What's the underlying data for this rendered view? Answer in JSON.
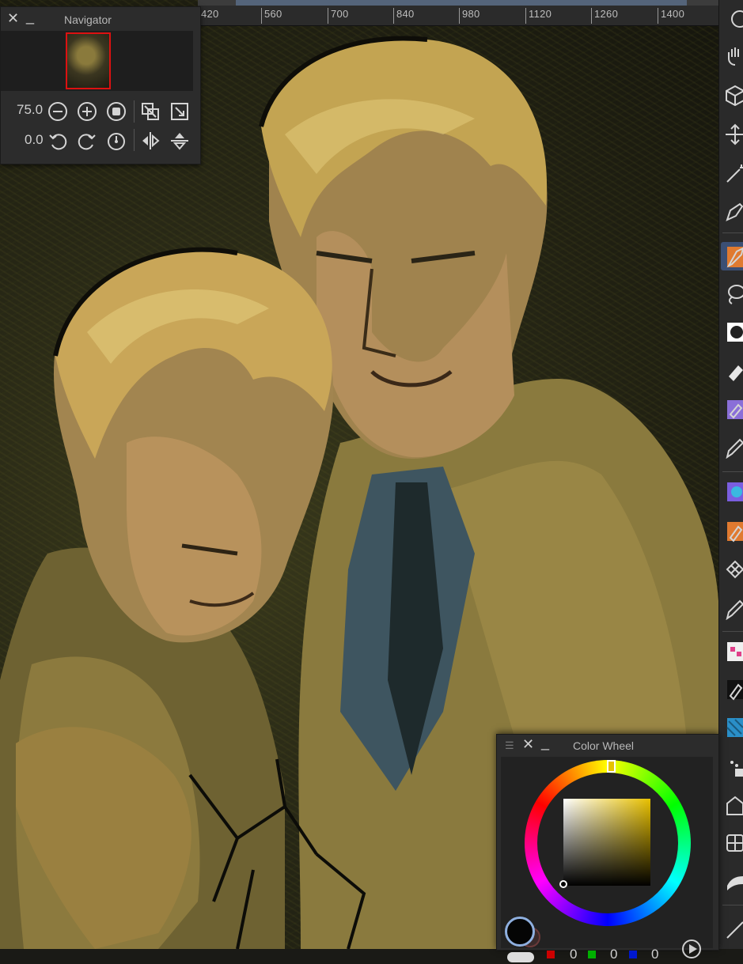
{
  "app": {
    "panels": {
      "navigator": {
        "title": "Navigator",
        "close_glyph": "✕",
        "minimize_glyph": "_",
        "zoom_value": "75.0",
        "rotation_value": "0.0",
        "icons": [
          "zoom-out-icon",
          "zoom-in-icon",
          "zoom-reset-icon",
          "fit-canvas-icon",
          "actual-size-icon",
          "rotate-ccw-icon",
          "rotate-cw-icon",
          "rotation-reset-icon",
          "flip-horizontal-icon",
          "flip-vertical-icon"
        ]
      },
      "color_wheel": {
        "title": "Color Wheel",
        "close_glyph": "✕",
        "minimize_glyph": "_",
        "grip_glyph": "☰",
        "selected_hue": "#e6c200",
        "foreground_color": "#050505",
        "r_value": "0",
        "g_value": "0",
        "b_value": "0",
        "channel_colors": {
          "r": "#cc0000",
          "g": "#00b000",
          "b": "#0018d0"
        }
      }
    },
    "ruler": {
      "labels": [
        "420",
        "560",
        "700",
        "840",
        "980",
        "1120",
        "1260",
        "1400"
      ]
    },
    "toolbar": {
      "tools": [
        "ellipse-select-icon",
        "hand-icon",
        "3d-cube-icon",
        "move-icon",
        "magic-wand-icon",
        "pen-icon",
        "brush-icon",
        "lasso-icon",
        "fill-color-icon",
        "eraser-icon",
        "gradient-icon",
        "pencil-icon",
        "watercolor-icon",
        "marker-icon",
        "pattern-icon",
        "ink-icon",
        "decoration-icon",
        "dark-brush-icon",
        "texture-icon",
        "spray-icon",
        "shape-icon",
        "grid-icon",
        "smudge-icon",
        "line-icon"
      ],
      "active_tool": "brush-icon"
    },
    "colors": {
      "panel_bg": "#2c2c2c",
      "accent": "#3b4f74"
    }
  }
}
